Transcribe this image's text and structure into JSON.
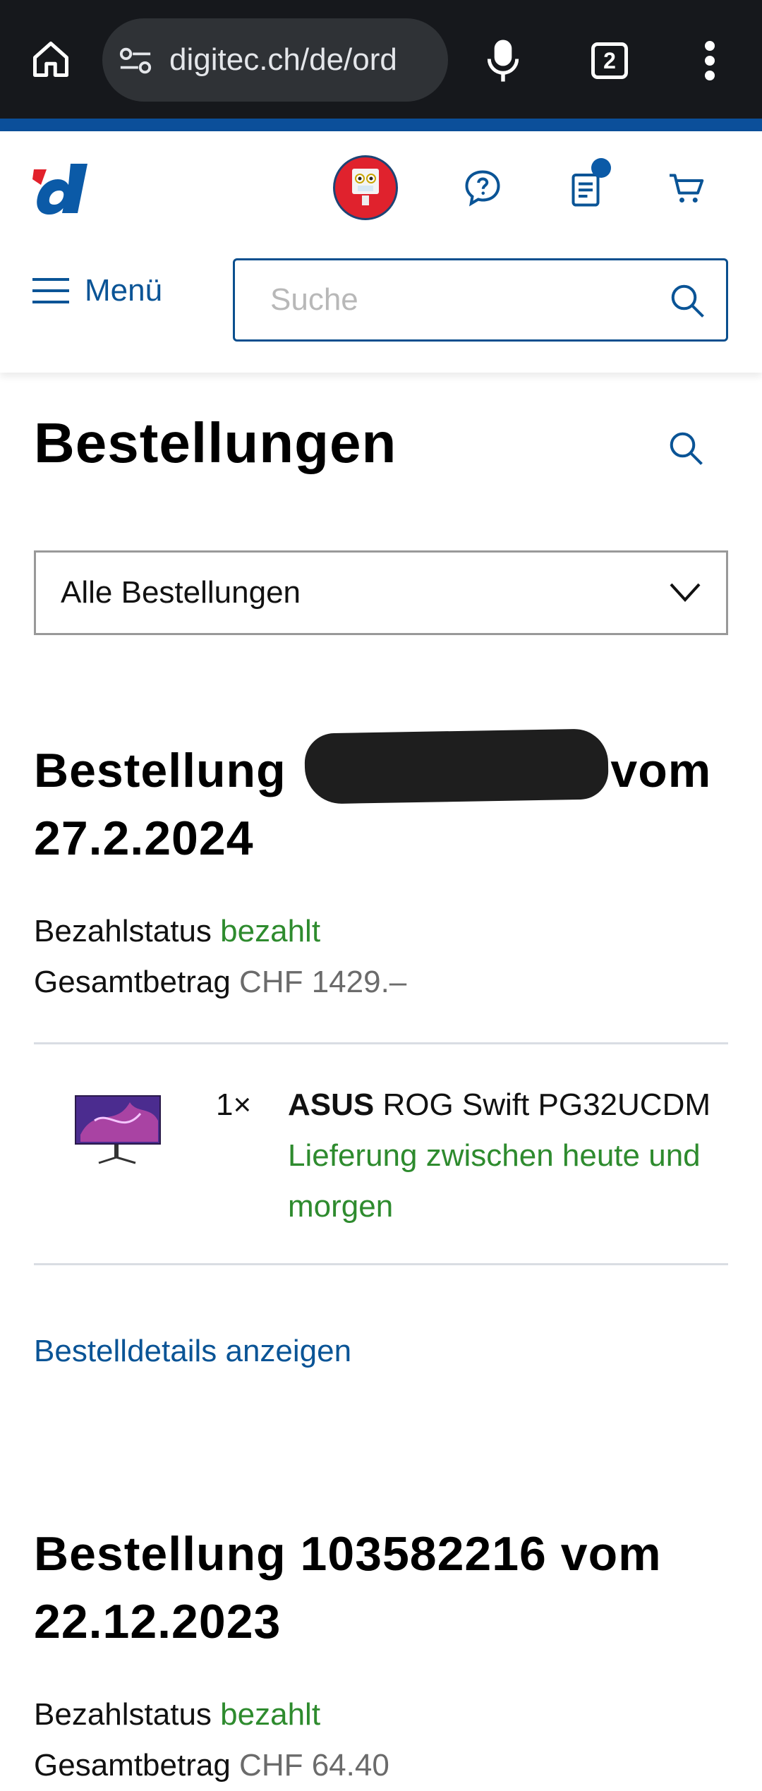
{
  "browser": {
    "url": "digitec.ch/de/ord",
    "tab_count": "2"
  },
  "header": {
    "menu_label": "Menü",
    "search_placeholder": "Suche",
    "notification_color": "#0b5aa7"
  },
  "page": {
    "title": "Bestellungen",
    "filter_selected": "Alle Bestellungen"
  },
  "orders": [
    {
      "heading_prefix": "Bestellung",
      "heading_suffix": "vom",
      "date": "27.2.2024",
      "payment_label": "Bezahlstatus",
      "payment_status": "bezahlt",
      "total_label": "Gesamtbetrag",
      "total_value": "CHF 1429.–",
      "items": [
        {
          "qty": "1×",
          "brand": "ASUS",
          "name": "ROG Swift PG32UCDM",
          "delivery": "Lieferung zwischen heute und morgen"
        }
      ],
      "details_link": "Bestelldetails anzeigen"
    },
    {
      "heading": "Bestellung 103582216 vom",
      "date": "22.12.2023",
      "payment_label": "Bezahlstatus",
      "payment_status": "bezahlt",
      "total_label": "Gesamtbetrag",
      "total_value": "CHF 64.40"
    }
  ],
  "colors": {
    "brand_blue": "#0a5496",
    "status_green": "#2e8b2e",
    "chrome_bg": "#16181c"
  }
}
